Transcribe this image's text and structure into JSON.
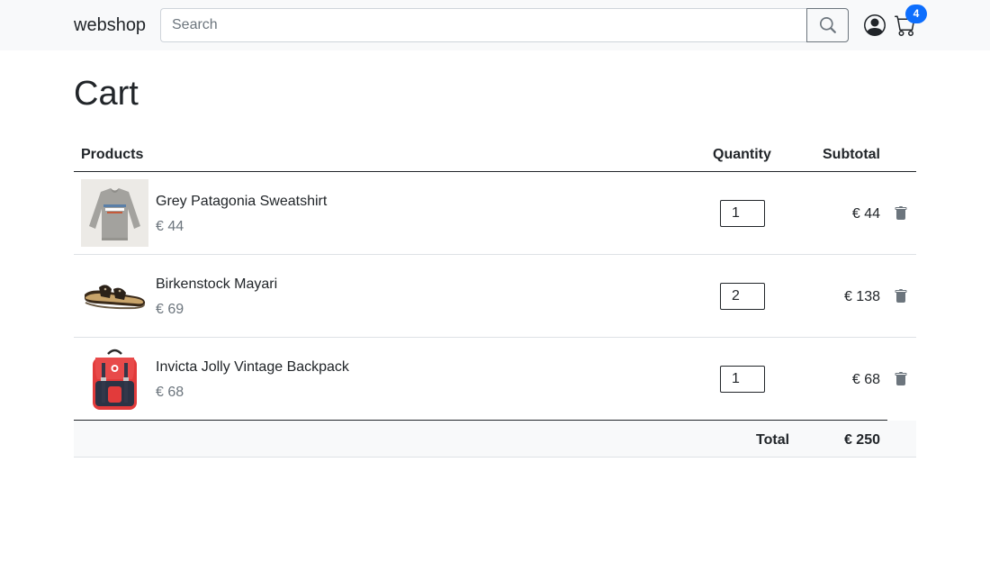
{
  "navbar": {
    "brand": "webshop",
    "search_placeholder": "Search",
    "cart_count": "4",
    "icons": {
      "search": "search-icon",
      "account": "person-circle-icon",
      "cart": "cart-icon"
    }
  },
  "page": {
    "title": "Cart"
  },
  "table": {
    "headers": {
      "products": "Products",
      "quantity": "Quantity",
      "subtotal": "Subtotal"
    },
    "rows": [
      {
        "name": "Grey Patagonia Sweatshirt",
        "price": "€ 44",
        "quantity": "1",
        "subtotal": "€ 44",
        "image": "grey-sweatshirt-image"
      },
      {
        "name": "Birkenstock Mayari",
        "price": "€ 69",
        "quantity": "2",
        "subtotal": "€ 138",
        "image": "sandal-image"
      },
      {
        "name": "Invicta Jolly Vintage Backpack",
        "price": "€ 68",
        "quantity": "1",
        "subtotal": "€ 68",
        "image": "red-backpack-image"
      }
    ],
    "footer": {
      "total_label": "Total",
      "total_value": "€ 250"
    }
  },
  "colors": {
    "accent": "#0d6efd",
    "navbar_bg": "#f8f9fa",
    "muted": "#6c757d"
  }
}
